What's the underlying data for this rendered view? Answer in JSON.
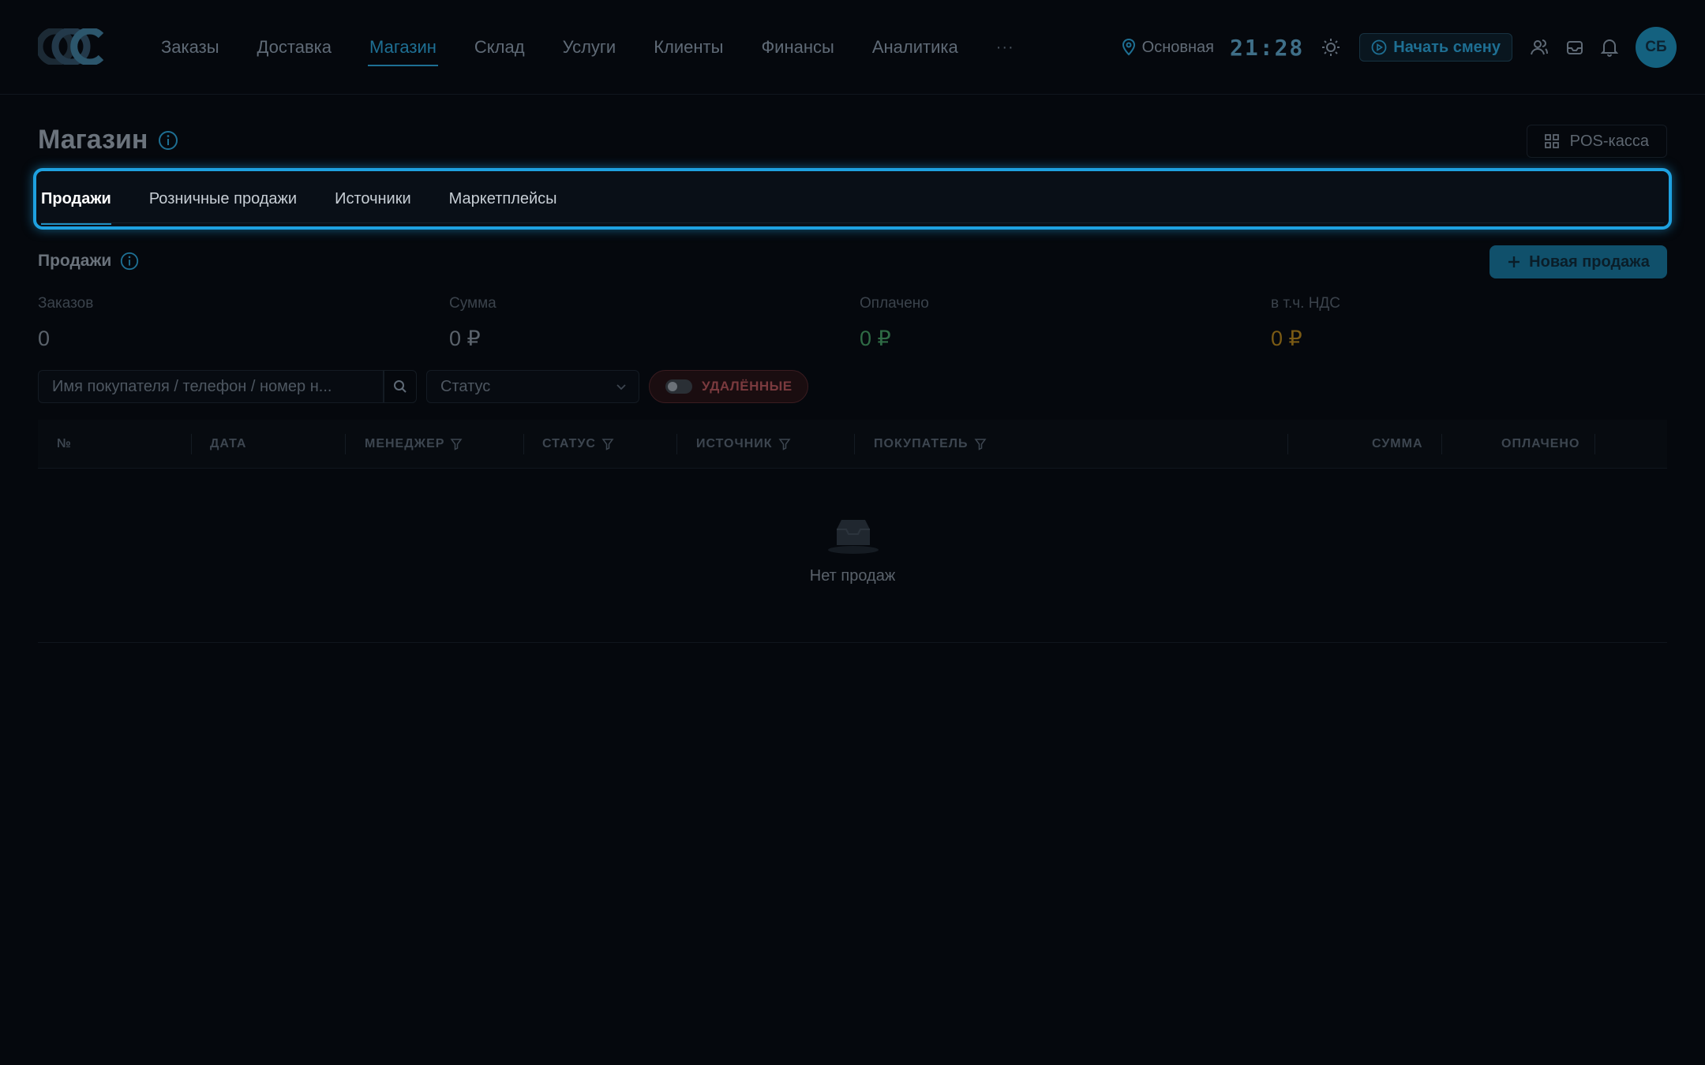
{
  "nav": {
    "items": [
      {
        "label": "Заказы"
      },
      {
        "label": "Доставка"
      },
      {
        "label": "Магазин"
      },
      {
        "label": "Склад"
      },
      {
        "label": "Услуги"
      },
      {
        "label": "Клиенты"
      },
      {
        "label": "Финансы"
      },
      {
        "label": "Аналитика"
      }
    ],
    "active": "Магазин",
    "more_label": "···"
  },
  "header": {
    "location": "Основная",
    "clock": "21:28",
    "shift_button": "Начать смену",
    "avatar_initials": "СБ",
    "accent_color": "#1e6f93"
  },
  "page": {
    "title": "Магазин",
    "pos_button": "POS-касса"
  },
  "tabs": [
    {
      "label": "Продажи",
      "active": true
    },
    {
      "label": "Розничные продажи",
      "active": false
    },
    {
      "label": "Источники",
      "active": false
    },
    {
      "label": "Маркетплейсы",
      "active": false
    }
  ],
  "section": {
    "title": "Продажи",
    "new_button": "Новая продажа"
  },
  "stats": [
    {
      "label": "Заказов",
      "value": "0",
      "color": "#5a626b"
    },
    {
      "label": "Сумма",
      "value": "0 ₽",
      "color": "#5a626b"
    },
    {
      "label": "Оплачено",
      "value": "0 ₽",
      "color": "#2f6b45"
    },
    {
      "label": "в т.ч. НДС",
      "value": "0 ₽",
      "color": "#7a5a14"
    }
  ],
  "filters": {
    "search_placeholder": "Имя покупателя / телефон / номер н...",
    "status_placeholder": "Статус",
    "deleted_label": "УДАЛЁННЫЕ"
  },
  "table": {
    "columns": [
      "№",
      "ДАТА",
      "МЕНЕДЖЕР",
      "СТАТУС",
      "ИСТОЧНИК",
      "ПОКУПАТЕЛЬ",
      "СУММА",
      "ОПЛАЧЕНО"
    ],
    "empty_text": "Нет продаж"
  }
}
